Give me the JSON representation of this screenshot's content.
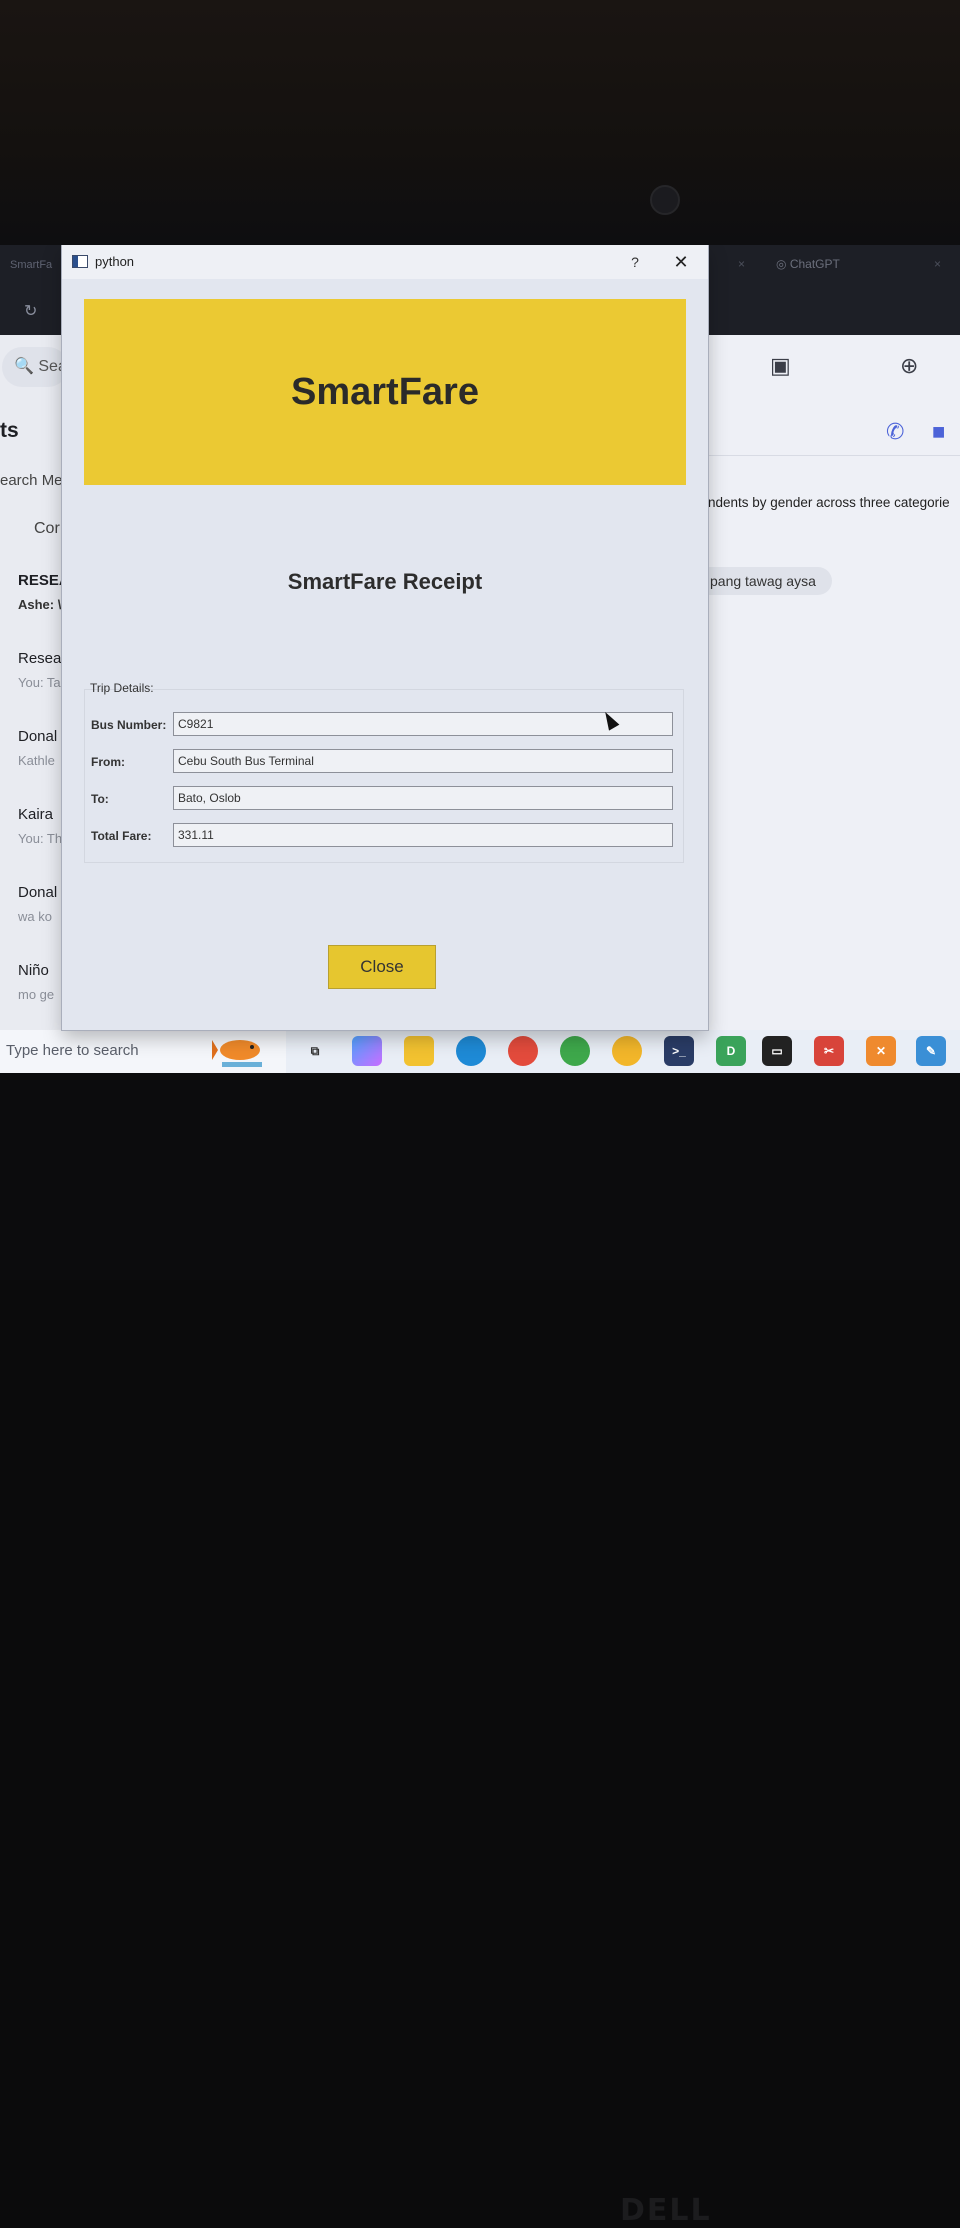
{
  "dialog": {
    "window_title": "python",
    "help_glyph": "?",
    "close_glyph": "✕",
    "banner_title": "SmartFare",
    "receipt_title": "SmartFare Receipt",
    "group_label": "Trip Details:",
    "fields": [
      {
        "label": "Bus Number:",
        "value": "C9821"
      },
      {
        "label": "From:",
        "value": "Cebu South Bus Terminal"
      },
      {
        "label": "To:",
        "value": "Bato, Oslob"
      },
      {
        "label": "Total Fare:",
        "value": "331.11"
      }
    ],
    "close_button": "Close",
    "banner_color": "#ebc933"
  },
  "background_browser": {
    "tab_left": "SmartFa",
    "tab_right": "ChatGPT",
    "tab_close": "×",
    "search_text": "Sea",
    "section_title": "ts",
    "search_messages": "earch Me",
    "conv_label": "Cor",
    "chats": [
      {
        "name": "RESEA",
        "sub": "Ashe: \\"
      },
      {
        "name": "Resea",
        "sub": "You: Ta"
      },
      {
        "name": "Donal",
        "sub": "Kathle"
      },
      {
        "name": "Kaira",
        "sub": "You: Th"
      },
      {
        "name": "Donal",
        "sub": "wa ko"
      },
      {
        "name": "Niño",
        "sub": "mo ge"
      }
    ],
    "message_heading": "ndents by gender across three categorie",
    "message_bubble": "pang tawag aysa"
  },
  "taskbar": {
    "search_placeholder": "Type here to search",
    "icons": [
      "task-view",
      "copilot",
      "file-explorer",
      "edge",
      "chrome-1",
      "chrome-2",
      "chrome-3",
      "terminal",
      "d-app",
      "cmd",
      "snipping",
      "app-x",
      "paint"
    ]
  },
  "hardware": {
    "brand": "DELL"
  }
}
